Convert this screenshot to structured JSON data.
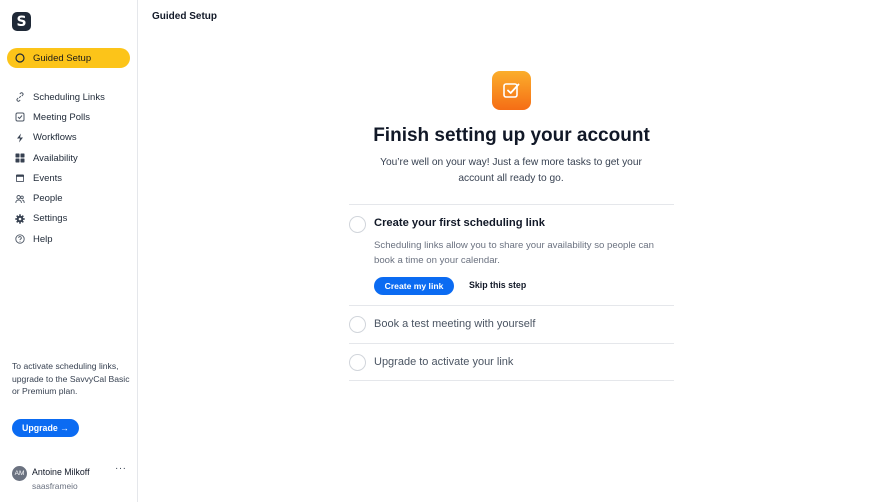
{
  "brand": {
    "logo_letter": "S"
  },
  "sidebar": {
    "items": [
      {
        "label": "Guided Setup",
        "icon": "circle-icon"
      },
      {
        "label": "Scheduling Links",
        "icon": "link-icon"
      },
      {
        "label": "Meeting Polls",
        "icon": "checkbox-icon"
      },
      {
        "label": "Workflows",
        "icon": "bolt-icon"
      },
      {
        "label": "Availability",
        "icon": "grid-icon"
      },
      {
        "label": "Events",
        "icon": "calendar-icon"
      },
      {
        "label": "People",
        "icon": "people-icon"
      },
      {
        "label": "Settings",
        "icon": "gear-icon"
      },
      {
        "label": "Help",
        "icon": "help-icon"
      }
    ],
    "upgrade_note": "To activate scheduling links, upgrade to the SavvyCal Basic or Premium plan.",
    "upgrade_label": "Upgrade →",
    "user": {
      "initials": "AM",
      "name": "Antoine Milkoff",
      "handle": "saasframeio",
      "more": "···"
    }
  },
  "header": {
    "title": "Guided Setup"
  },
  "main": {
    "title": "Finish setting up your account",
    "subtitle": "You’re well on your way! Just a few more tasks to get your account all ready to go.",
    "tasks": [
      {
        "title": "Create your first scheduling link",
        "description": "Scheduling links allow you to share your availability so people can book a time on your calendar.",
        "primary_label": "Create my link",
        "secondary_label": "Skip this step"
      },
      {
        "title": "Book a test meeting with yourself"
      },
      {
        "title": "Upgrade to activate your link"
      }
    ]
  },
  "colors": {
    "accent": "#fcc419",
    "primary": "#0b6bf2",
    "icon_gradient_top": "#fbae2c",
    "icon_gradient_bottom": "#f56d15"
  }
}
